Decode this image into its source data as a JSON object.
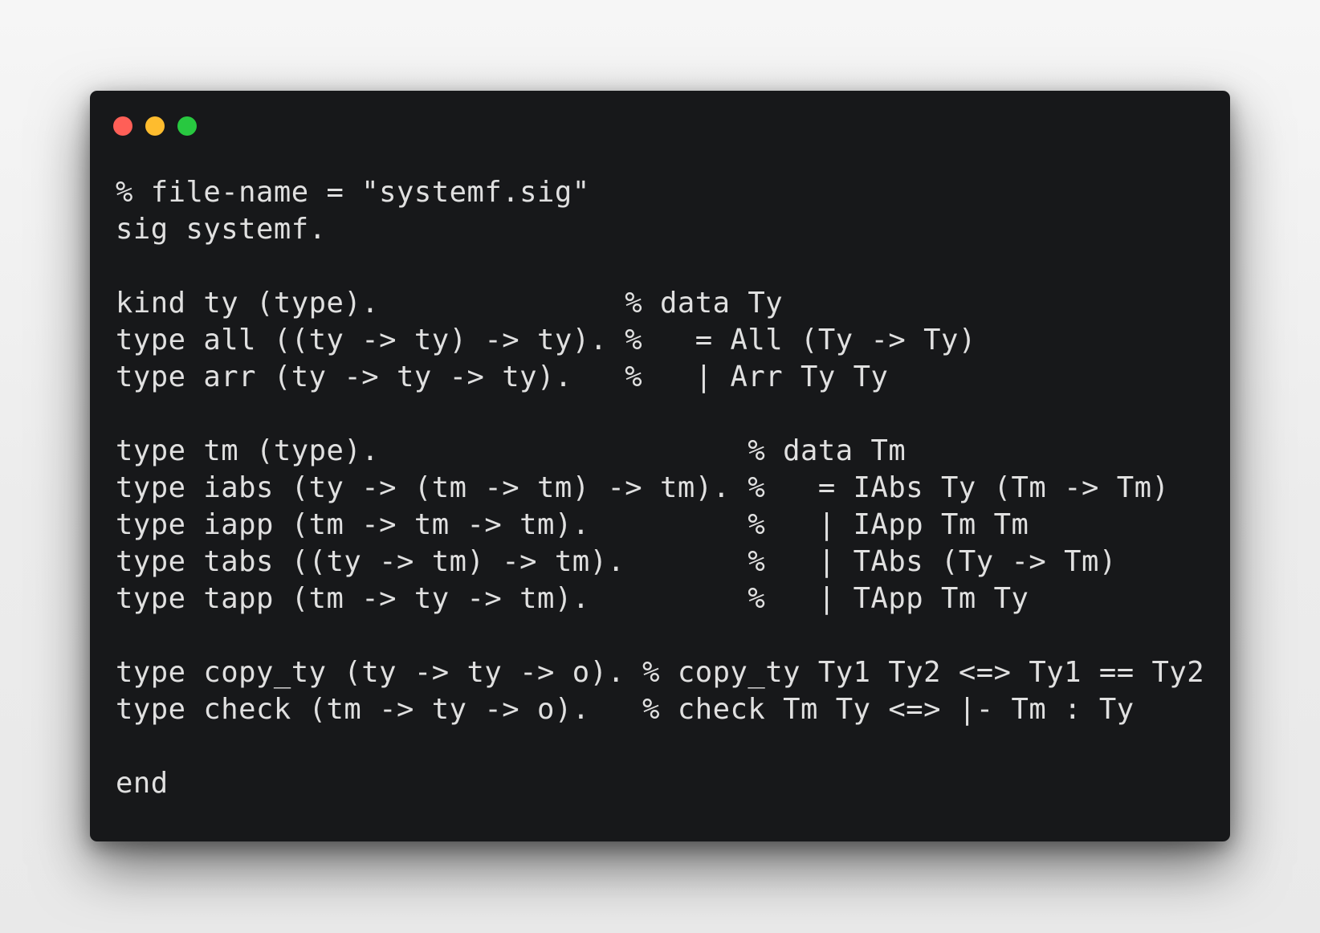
{
  "window": {
    "controls": [
      {
        "name": "close",
        "color": "#ff5f57"
      },
      {
        "name": "minimize",
        "color": "#febc2e"
      },
      {
        "name": "maximize",
        "color": "#28c840"
      }
    ]
  },
  "code": {
    "lines": [
      "% file-name = \"systemf.sig\"",
      "sig systemf.",
      "",
      "kind ty (type).              % data Ty",
      "type all ((ty -> ty) -> ty). %   = All (Ty -> Ty)",
      "type arr (ty -> ty -> ty).   %   | Arr Ty Ty",
      "",
      "type tm (type).                     % data Tm",
      "type iabs (ty -> (tm -> tm) -> tm). %   = IAbs Ty (Tm -> Tm)",
      "type iapp (tm -> tm -> tm).         %   | IApp Tm Tm",
      "type tabs ((ty -> tm) -> tm).       %   | TAbs (Ty -> Tm)",
      "type tapp (tm -> ty -> tm).         %   | TApp Tm Ty",
      "",
      "type copy_ty (ty -> ty -> o). % copy_ty Ty1 Ty2 <=> Ty1 == Ty2",
      "type check (tm -> ty -> o).   % check Tm Ty <=> |- Tm : Ty",
      "",
      "end"
    ]
  }
}
